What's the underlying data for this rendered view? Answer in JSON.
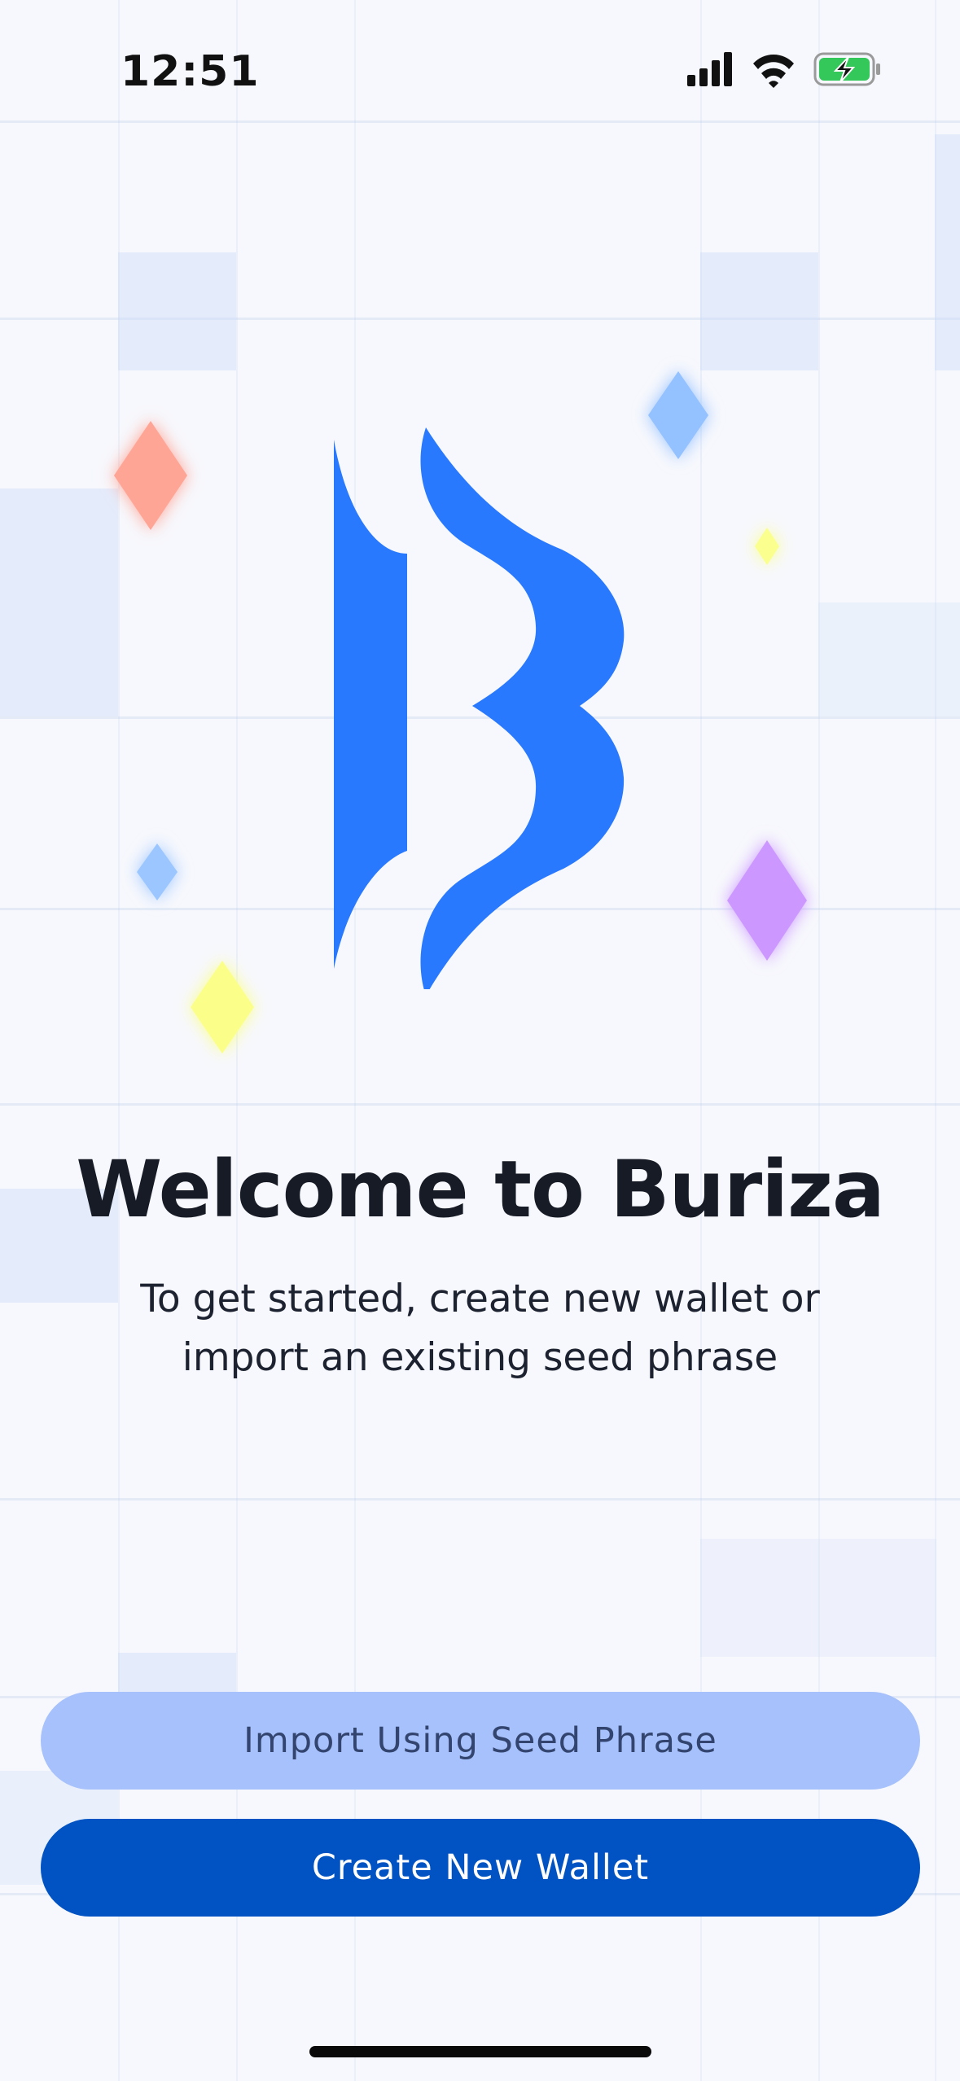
{
  "status_bar": {
    "time": "12:51",
    "icons": [
      "signal-icon",
      "wifi-icon",
      "battery-charging-icon"
    ]
  },
  "logo": {
    "name": "buriza-logo-icon",
    "color": "#2979ff"
  },
  "sparkles": [
    {
      "name": "sparkle-icon",
      "color": "#ff9c8a"
    },
    {
      "name": "sparkle-icon",
      "color": "#8cbcff"
    },
    {
      "name": "sparkle-icon",
      "color": "#fbff8a"
    },
    {
      "name": "sparkle-icon",
      "color": "#c98bff"
    }
  ],
  "welcome": {
    "title": "Welcome to Buriza",
    "subtitle": "To get started, create new wallet or import an existing seed phrase"
  },
  "actions": {
    "import_label": "Import Using Seed Phrase",
    "create_label": "Create New Wallet"
  },
  "colors": {
    "import_button": "#a6c1fb",
    "create_button": "#0153c3",
    "background": "#f7f8fd"
  }
}
